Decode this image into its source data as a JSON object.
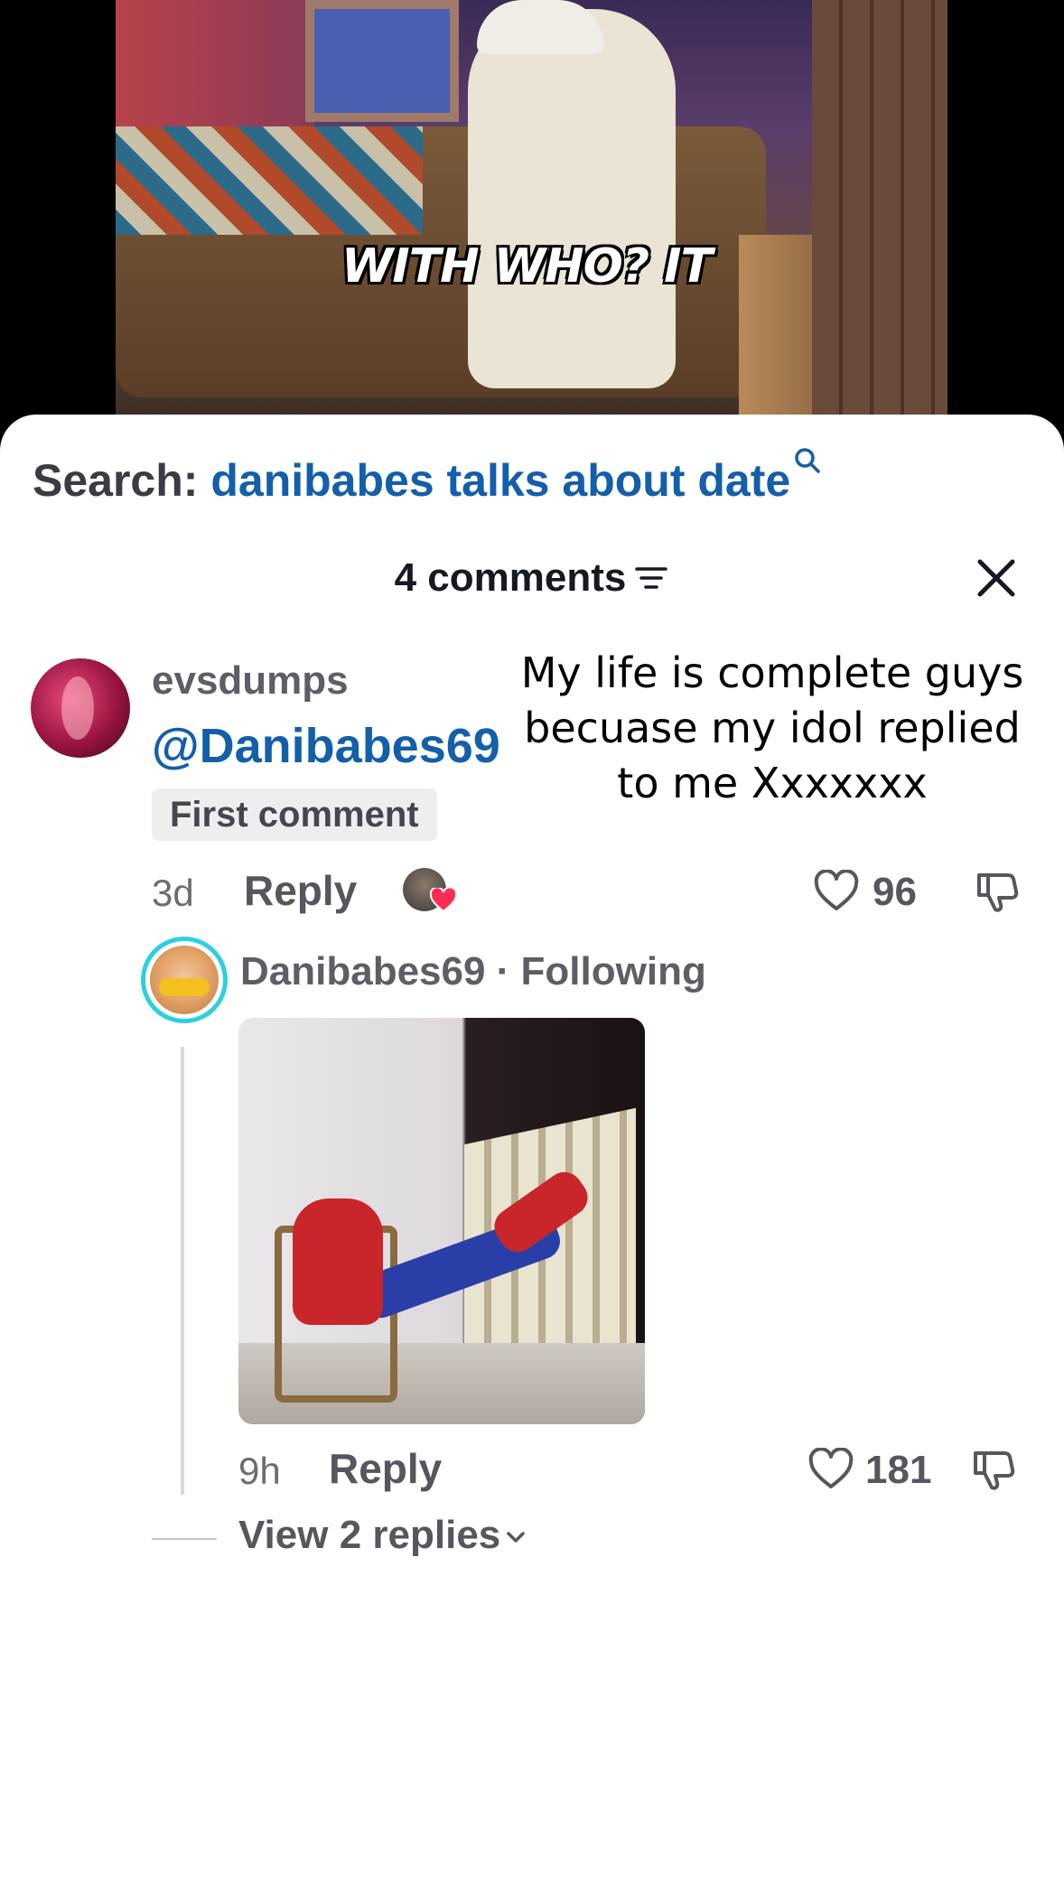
{
  "video": {
    "caption": "WITH WHO? IT"
  },
  "search": {
    "label": "Search:",
    "query": "danibabes talks about date"
  },
  "comments": {
    "count_label": "4 comments"
  },
  "top_comment": {
    "username": "evsdumps",
    "mention": "@Danibabes69",
    "badge": "First comment",
    "time": "3d",
    "reply_label": "Reply",
    "likes": "96"
  },
  "overlay_text": "My life is complete guys becuase my idol replied to me Xxxxxxx",
  "reply": {
    "user_line": "Danibabes69 · Following",
    "time": "9h",
    "reply_label": "Reply",
    "likes": "181"
  },
  "view_replies": "View 2 replies",
  "colors": {
    "link_blue": "#135fa9",
    "avatar_ring": "#2ecfe0",
    "heart_red": "#fe2c55"
  }
}
